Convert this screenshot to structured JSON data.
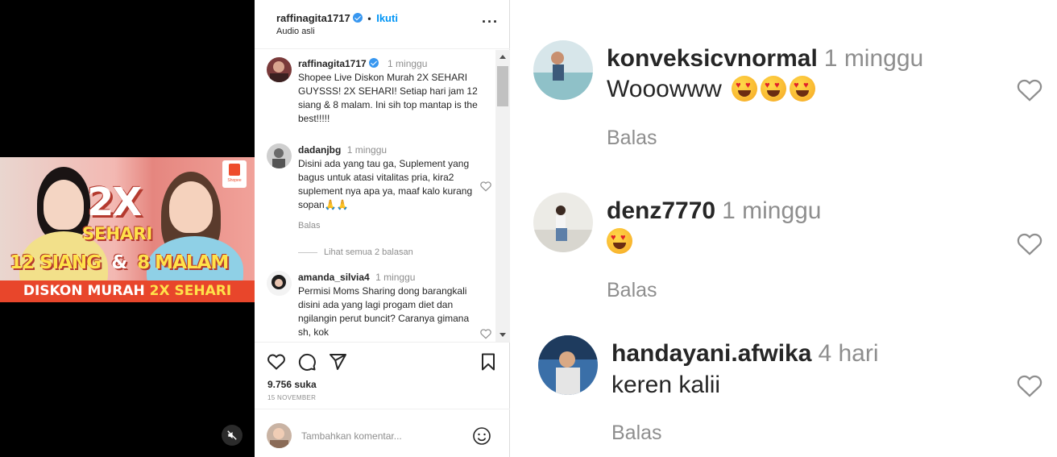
{
  "video": {
    "thumb_2x": "2X",
    "thumb_sehari": "SEHARI",
    "thumb_time_a": "12 SIANG",
    "thumb_amp": "&",
    "thumb_time_b": "8 MALAM",
    "banner_main": "DISKON MURAH",
    "banner_highlight": "2X SEHARI",
    "shopee_tag": "Shopee"
  },
  "post": {
    "header": {
      "username": "raffinagita1717",
      "follow_label": "Ikuti",
      "dot": "•",
      "audio_label": "Audio asli",
      "more": "···"
    },
    "caption": {
      "username": "raffinagita1717",
      "time": "1 minggu",
      "text": "Shopee Live Diskon Murah 2X SEHARI GUYSSS! 2X SEHARI! Setiap hari jam 12 siang & 8 malam. Ini sih top mantap is the best!!!!!"
    },
    "comments": [
      {
        "username": "dadanjbg",
        "time": "1 minggu",
        "text": "Disini ada yang tau ga, Suplement yang bagus untuk atasi vitalitas pria, kira2 suplement nya apa ya, maaf kalo kurang sopan🙏🙏",
        "reply_label": "Balas"
      },
      {
        "username": "amanda_silvia4",
        "time": "1 minggu",
        "text": "Permisi Moms Sharing dong barangkali disini ada yang lagi progam diet dan ngilangin perut buncit? Caranya gimana sh, kok"
      }
    ],
    "view_replies_label": "Lihat semua 2 balasan",
    "likes": "9.756 suka",
    "date": "15 NOVEMBER",
    "add_comment_placeholder": "Tambahkan komentar..."
  },
  "zoom": {
    "comments": [
      {
        "username": "konveksicvnormal",
        "time": "1 minggu",
        "text": "Wooowww",
        "reply_label": "Balas"
      },
      {
        "username": "denz7770",
        "time": "1 minggu",
        "text": "",
        "reply_label": "Balas"
      },
      {
        "username": "handayani.afwika",
        "time": "4 hari",
        "text": "keren kalii",
        "reply_label": "Balas"
      }
    ]
  },
  "colors": {
    "accent": "#0095f6",
    "verified": "#3897f0",
    "muted": "#8e8e8e",
    "banner": "#e8462b"
  }
}
